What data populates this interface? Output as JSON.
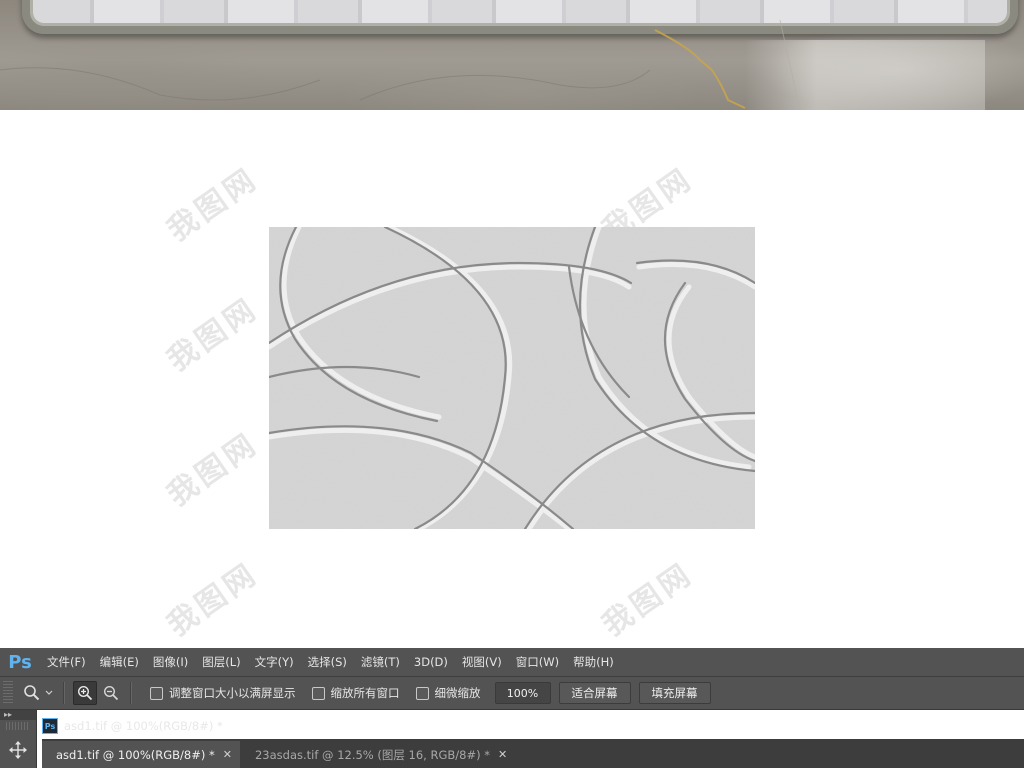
{
  "watermark_text": "我图网",
  "menubar": {
    "logo": "Ps",
    "items": [
      {
        "label": "文件(F)"
      },
      {
        "label": "编辑(E)"
      },
      {
        "label": "图像(I)"
      },
      {
        "label": "图层(L)"
      },
      {
        "label": "文字(Y)"
      },
      {
        "label": "选择(S)"
      },
      {
        "label": "滤镜(T)"
      },
      {
        "label": "3D(D)"
      },
      {
        "label": "视图(V)"
      },
      {
        "label": "窗口(W)"
      },
      {
        "label": "帮助(H)"
      }
    ]
  },
  "options_bar": {
    "resize_windows_label": "调整窗口大小以满屏显示",
    "zoom_all_windows_label": "缩放所有窗口",
    "scrubby_zoom_label": "细微缩放",
    "zoom_value": "100%",
    "fit_screen_label": "适合屏幕",
    "fill_screen_label": "填充屏幕"
  },
  "document": {
    "title": "asd1.tif @ 100%(RGB/8#) *"
  },
  "tabs": [
    {
      "label": "asd1.tif @ 100%(RGB/8#) *",
      "active": true
    },
    {
      "label": "23asdas.tif @ 12.5% (图层 16, RGB/8#) *",
      "active": false
    }
  ],
  "icons": {
    "zoom_tool": "zoom-icon",
    "zoom_in": "zoom-in-icon",
    "zoom_out": "zoom-out-icon",
    "move_tool": "move-icon"
  },
  "colors": {
    "ps_logo": "#5fb3f0",
    "chrome_bg": "#535353",
    "tab_bar_bg": "#3d3d3d"
  }
}
